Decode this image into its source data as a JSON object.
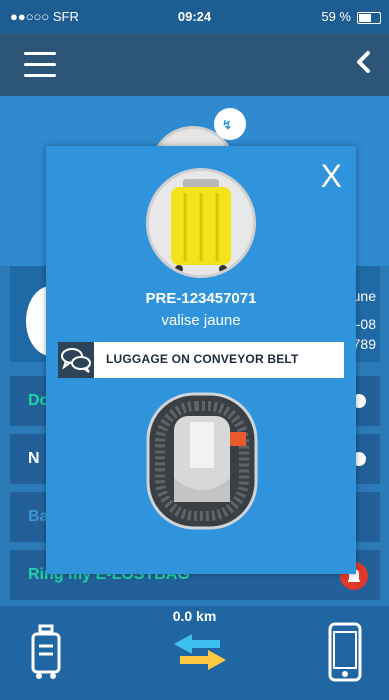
{
  "status_bar": {
    "carrier": "●●○○○ SFR",
    "time": "09:24",
    "battery_text": "59 %"
  },
  "background": {
    "row1_label": "Do",
    "row2_label": "N",
    "row3_label": "Ba",
    "ring_label": "Ring my E-LOSTBAG",
    "card_right_1": "une",
    "card_right_2": "-08",
    "card_right_3": "789",
    "distance": "0.0 km"
  },
  "modal": {
    "close_label": "X",
    "reference": "PRE-123457071",
    "description": "valise jaune",
    "status_text": "LUGGAGE ON CONVEYOR BELT"
  },
  "colors": {
    "accent": "#2f94dc",
    "nav": "#2d5577",
    "teal": "#1fd4a2",
    "alert": "#e0392b"
  },
  "icons": [
    "menu-icon",
    "back-chevron-icon",
    "chat-bubbles-icon",
    "suitcase-icon",
    "phone-icon",
    "swap-arrows-icon",
    "bell-icon"
  ]
}
